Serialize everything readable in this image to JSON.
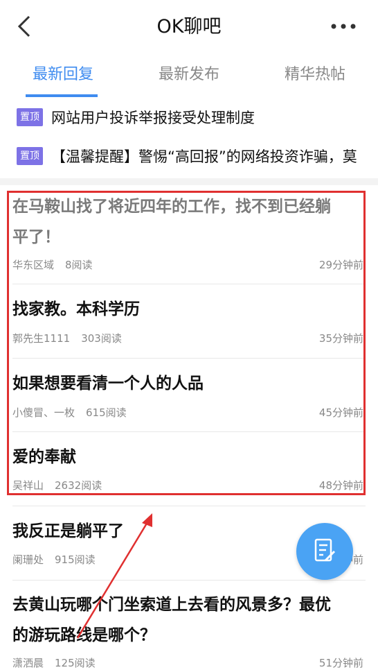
{
  "header": {
    "title": "OK聊吧",
    "back_icon": "chevron-left-icon",
    "more_icon": "more-horizontal-icon"
  },
  "tabs": [
    {
      "label": "最新回复",
      "active": true
    },
    {
      "label": "最新发布",
      "active": false
    },
    {
      "label": "精华热帖",
      "active": false
    }
  ],
  "pinned": [
    {
      "badge": "置顶",
      "text": "网站用户投诉举报接受处理制度"
    },
    {
      "badge": "置顶",
      "text": "【温馨提醒】警惕“高回报”的网络投资诈骗，莫"
    }
  ],
  "posts": [
    {
      "title_line1": "在马鞍山找了将近四年的工作，找不到已经躺",
      "title_line2": "平了！",
      "author": "华东区域",
      "reads": "8阅读",
      "time": "29分钟前"
    },
    {
      "title_line1": "找家教。本科学历",
      "author": "郭先生1111",
      "reads": "303阅读",
      "time": "35分钟前"
    },
    {
      "title_line1": "如果想要看清一个人的人品",
      "author": "小傻冒、一枚",
      "reads": "615阅读",
      "time": "45分钟前"
    },
    {
      "title_line1": "爱的奉献",
      "author": "吴祥山",
      "reads": "2632阅读",
      "time": "48分钟前"
    },
    {
      "title_line1": "我反正是躺平了",
      "author": "阑珊处",
      "reads": "915阅读",
      "time": "分钟前"
    },
    {
      "title_line1": "去黄山玩哪个门坐索道上去看的风景多？最优",
      "title_line2": "的游玩路线是哪个？",
      "author": "潇洒晨",
      "reads": "125阅读",
      "time": "51分钟前"
    }
  ],
  "fab": {
    "icon": "compose-icon"
  },
  "colors": {
    "accent": "#3f8cf0",
    "pin_badge": "#7d72e6",
    "highlight": "#e03030",
    "fab": "#4aa3f4"
  }
}
